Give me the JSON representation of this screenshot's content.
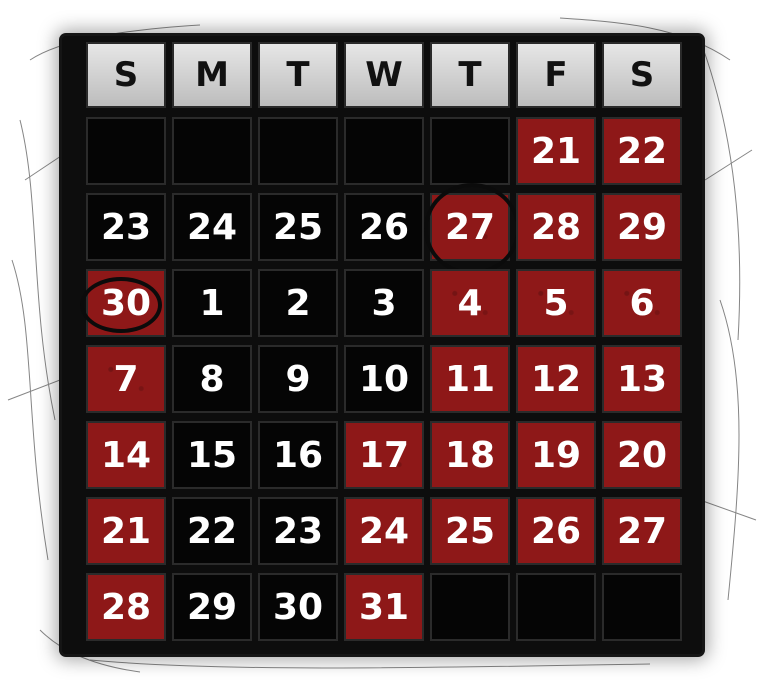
{
  "calendar": {
    "day_headers": [
      "S",
      "M",
      "T",
      "W",
      "T",
      "F",
      "S"
    ],
    "colors": {
      "red": "#8e1818",
      "black": "#050505",
      "header": "#d4d4d4"
    },
    "weeks": [
      [
        {
          "text": "",
          "color": "black"
        },
        {
          "text": "",
          "color": "black"
        },
        {
          "text": "",
          "color": "black"
        },
        {
          "text": "",
          "color": "black"
        },
        {
          "text": "",
          "color": "black"
        },
        {
          "text": "21",
          "color": "red"
        },
        {
          "text": "22",
          "color": "red"
        }
      ],
      [
        {
          "text": "23",
          "color": "black"
        },
        {
          "text": "24",
          "color": "black"
        },
        {
          "text": "25",
          "color": "black"
        },
        {
          "text": "26",
          "color": "black"
        },
        {
          "text": "27",
          "color": "red",
          "circled": true
        },
        {
          "text": "28",
          "color": "red"
        },
        {
          "text": "29",
          "color": "red"
        }
      ],
      [
        {
          "text": "30",
          "color": "red",
          "circled": true
        },
        {
          "text": "1",
          "color": "black"
        },
        {
          "text": "2",
          "color": "black"
        },
        {
          "text": "3",
          "color": "black"
        },
        {
          "text": "4",
          "color": "red"
        },
        {
          "text": "5",
          "color": "red"
        },
        {
          "text": "6",
          "color": "red"
        }
      ],
      [
        {
          "text": "7",
          "color": "red"
        },
        {
          "text": "8",
          "color": "black"
        },
        {
          "text": "9",
          "color": "black"
        },
        {
          "text": "10",
          "color": "black"
        },
        {
          "text": "11",
          "color": "red"
        },
        {
          "text": "12",
          "color": "red"
        },
        {
          "text": "13",
          "color": "red"
        }
      ],
      [
        {
          "text": "14",
          "color": "red"
        },
        {
          "text": "15",
          "color": "black"
        },
        {
          "text": "16",
          "color": "black"
        },
        {
          "text": "17",
          "color": "red"
        },
        {
          "text": "18",
          "color": "red"
        },
        {
          "text": "19",
          "color": "red"
        },
        {
          "text": "20",
          "color": "red"
        }
      ],
      [
        {
          "text": "21",
          "color": "red"
        },
        {
          "text": "22",
          "color": "black"
        },
        {
          "text": "23",
          "color": "black"
        },
        {
          "text": "24",
          "color": "red"
        },
        {
          "text": "25",
          "color": "red"
        },
        {
          "text": "26",
          "color": "red"
        },
        {
          "text": "27",
          "color": "red"
        }
      ],
      [
        {
          "text": "28",
          "color": "red"
        },
        {
          "text": "29",
          "color": "black"
        },
        {
          "text": "30",
          "color": "black"
        },
        {
          "text": "31",
          "color": "red"
        },
        {
          "text": "",
          "color": "black"
        },
        {
          "text": "",
          "color": "black"
        },
        {
          "text": "",
          "color": "black"
        }
      ]
    ]
  }
}
